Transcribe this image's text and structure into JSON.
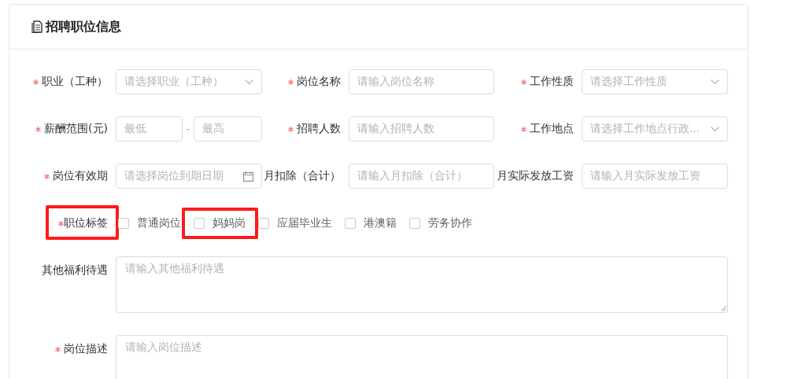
{
  "section": {
    "title": "招聘职位信息"
  },
  "rows": [
    [
      {
        "label": "职业（工种）",
        "required": true,
        "kind": "select",
        "placeholder": "请选择职业（工种）"
      },
      {
        "label": "岗位名称",
        "required": true,
        "kind": "input",
        "placeholder": "请输入岗位名称"
      },
      {
        "label": "工作性质",
        "required": true,
        "kind": "select",
        "placeholder": "请选择工作性质"
      }
    ],
    [
      {
        "label": "薪酬范围(元)",
        "required": true,
        "kind": "range",
        "placeholders": [
          "最低",
          "最高"
        ],
        "separator": "-"
      },
      {
        "label": "招聘人数",
        "required": true,
        "kind": "input",
        "placeholder": "请输入招聘人数"
      },
      {
        "label": "工作地点",
        "required": true,
        "kind": "select",
        "placeholder": "请选择工作地点行政..."
      }
    ],
    [
      {
        "label": "岗位有效期",
        "required": true,
        "kind": "date",
        "placeholder": "请选择岗位到期日期"
      },
      {
        "label": "月扣除（合计）",
        "required": false,
        "kind": "input",
        "placeholder": "请输入月扣除（合计）"
      },
      {
        "label": "月实际发放工资",
        "required": false,
        "kind": "input",
        "placeholder": "请输入月实际发放工资"
      }
    ]
  ],
  "tags": {
    "label": "职位标签",
    "required": true,
    "highlighted": true,
    "options": [
      {
        "label": "普通岗位",
        "checked": false,
        "highlighted": false
      },
      {
        "label": "妈妈岗",
        "checked": false,
        "highlighted": true
      },
      {
        "label": "应届毕业生",
        "checked": false,
        "highlighted": false
      },
      {
        "label": "港澳籍",
        "checked": false,
        "highlighted": false
      },
      {
        "label": "劳务协作",
        "checked": false,
        "highlighted": false
      }
    ]
  },
  "textareas": [
    {
      "label": "其他福利待遇",
      "required": false,
      "placeholder": "请输入其他福利待遇"
    },
    {
      "label": "岗位描述",
      "required": true,
      "placeholder": "请输入岗位描述"
    }
  ]
}
